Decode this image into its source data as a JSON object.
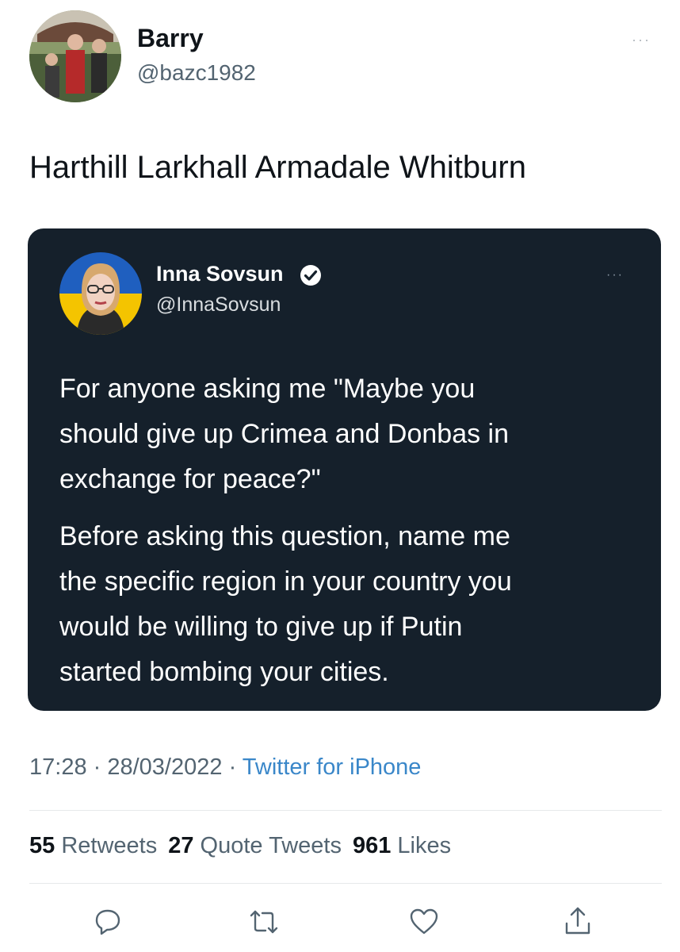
{
  "tweet": {
    "author": {
      "name": "Barry",
      "handle": "@bazc1982"
    },
    "more_label": "···",
    "text": "Harthill Larkhall Armadale Whitburn",
    "quoted": {
      "author": {
        "name": "Inna Sovsun",
        "handle": "@InnaSovsun",
        "verified": true
      },
      "more_label": "···",
      "paragraphs": [
        [
          "For anyone asking me \"Maybe you",
          "should give up Crimea and Donbas in",
          "exchange for peace?\""
        ],
        [
          "Before asking this question, name me",
          "the specific region in your country you",
          "would be willing to give up if Putin",
          "started bombing your cities."
        ]
      ]
    },
    "meta": {
      "time": "17:28",
      "separator": " · ",
      "date": "28/03/2022",
      "source": "Twitter for iPhone"
    },
    "stats": {
      "retweets_count": "55",
      "retweets_label": "Retweets",
      "quotes_count": "27",
      "quotes_label": "Quote Tweets",
      "likes_count": "961",
      "likes_label": "Likes"
    },
    "actions": [
      "reply-icon",
      "retweet-icon",
      "like-icon",
      "share-icon"
    ]
  },
  "colors": {
    "card_bg": "#15202b",
    "link": "#3a87c9",
    "muted": "#536471",
    "verified_badge": "#ffffff"
  }
}
